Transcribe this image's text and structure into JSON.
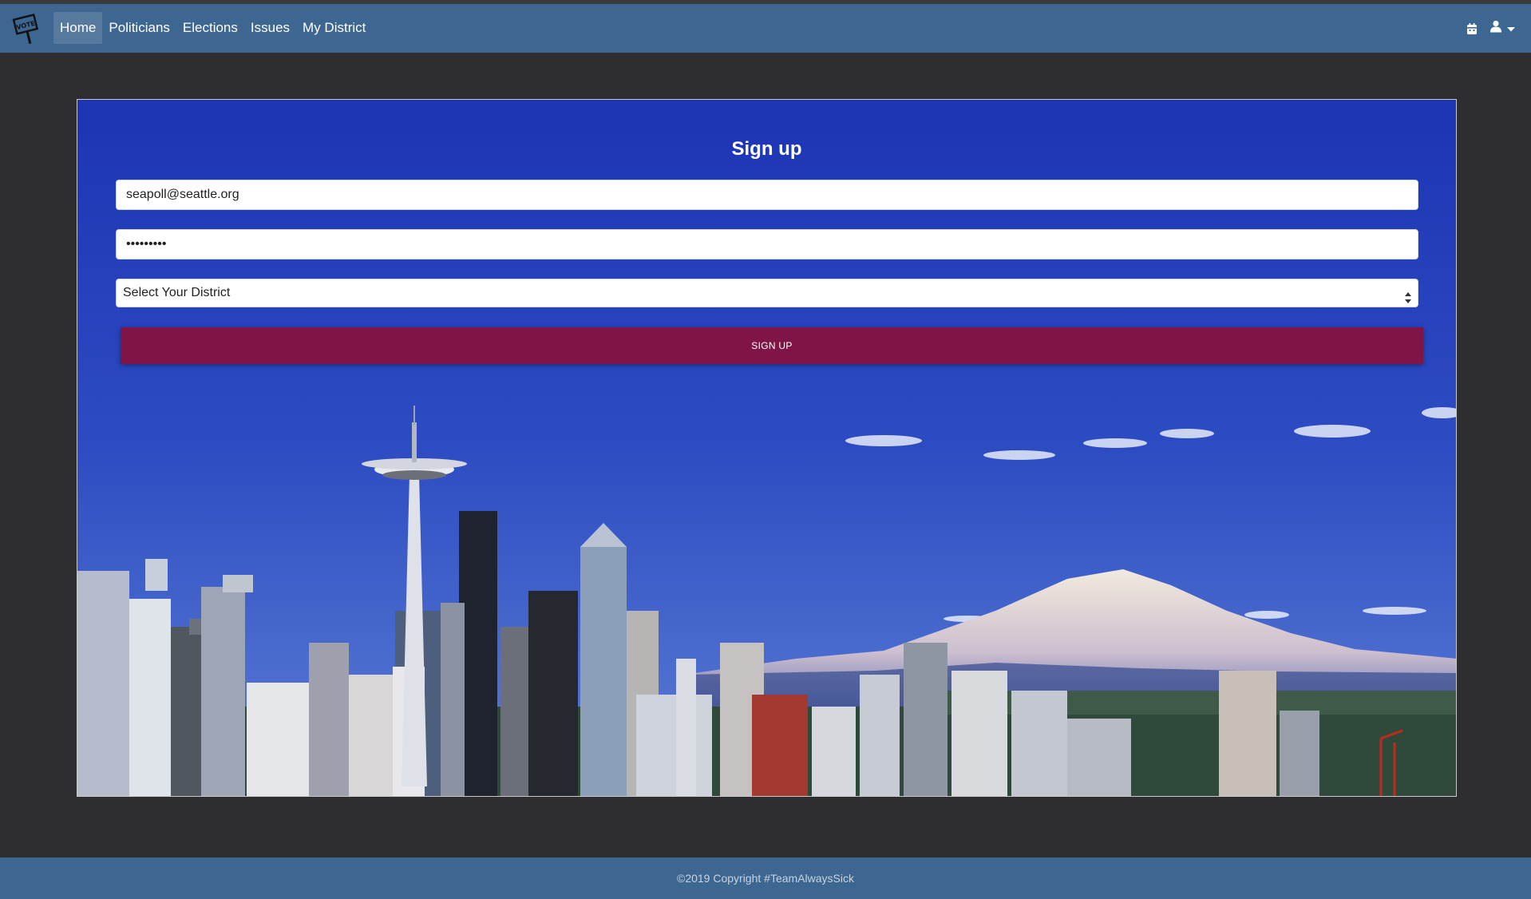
{
  "nav": {
    "logo_icon": "vote-sign-icon",
    "items": [
      {
        "label": "Home",
        "active": true
      },
      {
        "label": "Politicians",
        "active": false
      },
      {
        "label": "Elections",
        "active": false
      },
      {
        "label": "Issues",
        "active": false
      },
      {
        "label": "My District",
        "active": false
      }
    ],
    "right_icons": [
      "calendar-icon",
      "user-icon",
      "caret-down-icon"
    ]
  },
  "signup": {
    "title": "Sign up",
    "email_value": "seapoll@seattle.org",
    "password_value": "•••••••••",
    "district_selected": "Select Your District",
    "submit_label": "SIGN UP"
  },
  "footer": {
    "copyright": "©2019 Copyright #TeamAlwaysSick"
  },
  "colors": {
    "navbar": "#3d6791",
    "page_bg": "#2e2e30",
    "sky_top": "#1d34b4",
    "sky_bottom": "#3f66c9",
    "button": "#7e1546"
  }
}
